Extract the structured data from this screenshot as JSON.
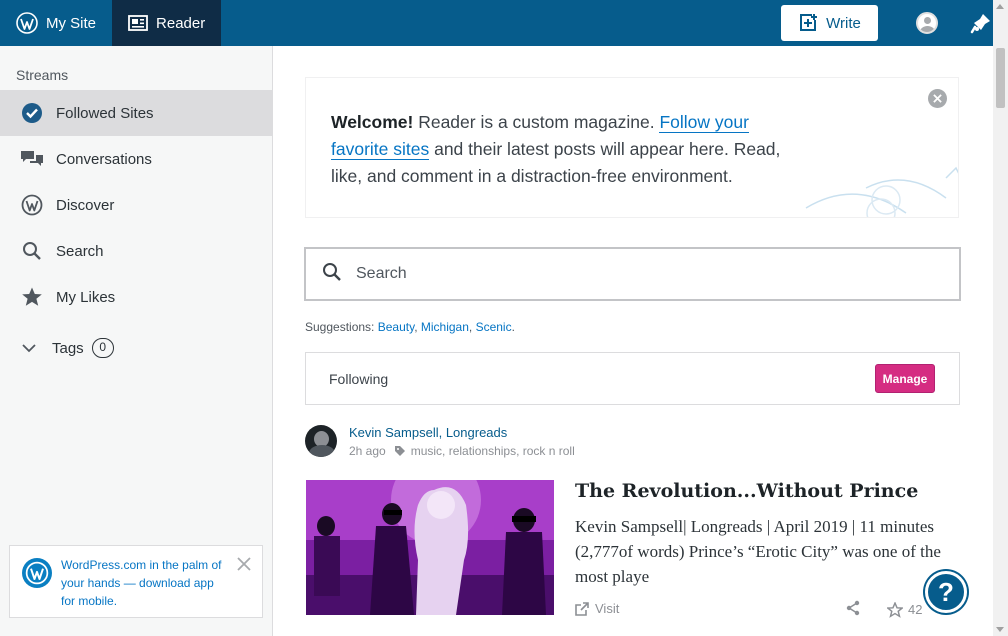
{
  "masterbar": {
    "my_site_label": "My Site",
    "reader_label": "Reader",
    "write_label": "Write"
  },
  "sidebar": {
    "heading": "Streams",
    "items": [
      {
        "label": "Followed Sites",
        "icon": "checkmark-circle-icon"
      },
      {
        "label": "Conversations",
        "icon": "chat-bubbles-icon"
      },
      {
        "label": "Discover",
        "icon": "wordpress-logo-icon"
      },
      {
        "label": "Search",
        "icon": "search-icon"
      },
      {
        "label": "My Likes",
        "icon": "star-icon"
      }
    ],
    "tags_label": "Tags",
    "tags_count": "0",
    "app_promo": "WordPress.com in the palm of your hands — download app for mobile."
  },
  "welcome": {
    "bold": "Welcome!",
    "text1": " Reader is a custom magazine. ",
    "link": "Follow your favorite sites",
    "text2": " and their latest posts will appear here. Read, like, and comment in a distraction-free environment."
  },
  "search": {
    "placeholder": "Search"
  },
  "suggestions": {
    "label": "Suggestions:",
    "items": [
      "Beauty",
      "Michigan",
      "Scenic"
    ]
  },
  "following": {
    "label": "Following",
    "manage_label": "Manage"
  },
  "post": {
    "author": "Kevin Sampsell, Longreads",
    "time": "2h ago",
    "tags": "music, relationships, rock n roll",
    "title": "The Revolution...Without Prince",
    "excerpt": "Kevin Sampsell| Longreads | April 2019 | 11 minutes (2,777of words) Prince’s “Erotic City” was one of the most playe",
    "visit_label": "Visit",
    "like_count": "42"
  },
  "help": {
    "label": "?"
  },
  "colors": {
    "masterbar": "#065c8c",
    "masterbar_active": "#0f2c46",
    "link": "#0675c4",
    "manage": "#d52c82"
  }
}
